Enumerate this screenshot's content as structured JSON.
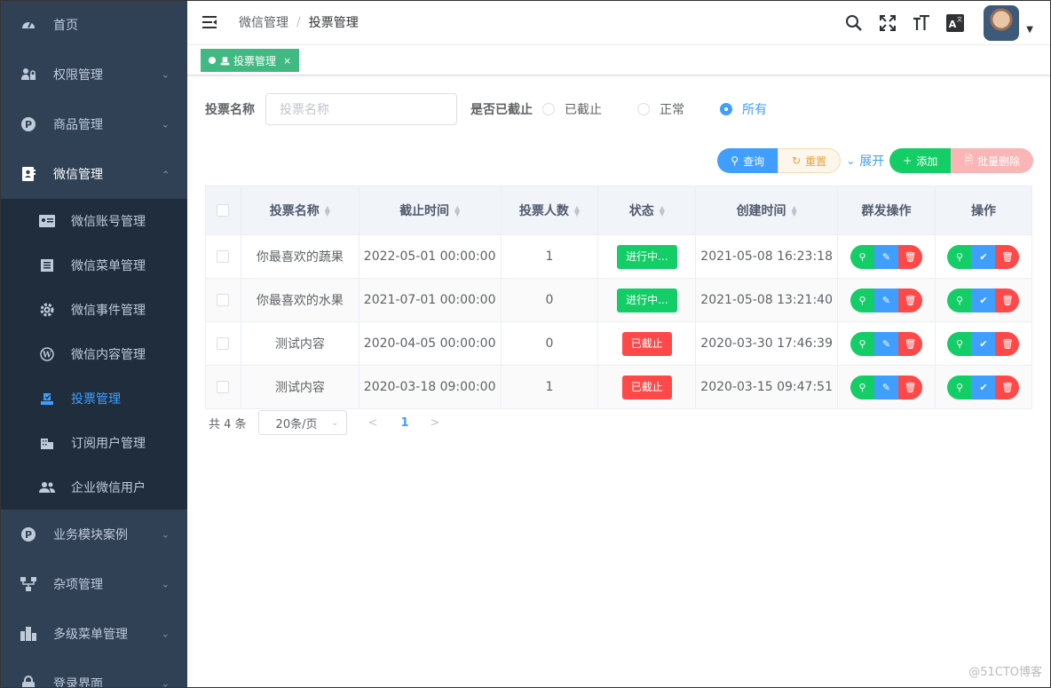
{
  "sidebar": {
    "home": "首页",
    "permission": "权限管理",
    "goods": "商品管理",
    "wechat": "微信管理",
    "wechat_sub": [
      {
        "label": "微信账号管理"
      },
      {
        "label": "微信菜单管理"
      },
      {
        "label": "微信事件管理"
      },
      {
        "label": "微信内容管理"
      },
      {
        "label": "投票管理"
      },
      {
        "label": "订阅用户管理"
      },
      {
        "label": "企业微信用户"
      }
    ],
    "business": "业务模块案例",
    "misc": "杂项管理",
    "multilevel": "多级菜单管理",
    "login": "登录界面"
  },
  "header": {
    "breadcrumb_parent": "微信管理",
    "breadcrumb_sep": "/",
    "breadcrumb_current": "投票管理"
  },
  "tags": {
    "active_label": "投票管理",
    "close": "×"
  },
  "search": {
    "name_label": "投票名称",
    "name_placeholder": "投票名称",
    "status_label": "是否已截止",
    "options": [
      "已截止",
      "正常",
      "所有"
    ],
    "selected": "所有"
  },
  "toolbar": {
    "query": "查询",
    "reset": "重置",
    "expand": "展开",
    "add": "添加",
    "batch_delete": "批量删除"
  },
  "table": {
    "headers": [
      "投票名称",
      "截止时间",
      "投票人数",
      "状态",
      "创建时间",
      "群发操作",
      "操作"
    ],
    "rows": [
      {
        "name": "你最喜欢的蔬果",
        "deadline": "2022-05-01 00:00:00",
        "count": "1",
        "status": "进行中...",
        "created": "2021-05-08 16:23:18"
      },
      {
        "name": "你最喜欢的水果",
        "deadline": "2021-07-01 00:00:00",
        "count": "0",
        "status": "进行中...",
        "created": "2021-05-08 13:21:40"
      },
      {
        "name": "测试内容",
        "deadline": "2020-04-05 00:00:00",
        "count": "0",
        "status": "已截止",
        "created": "2020-03-30 17:46:39"
      },
      {
        "name": "测试内容",
        "deadline": "2020-03-18 09:00:00",
        "count": "1",
        "status": "已截止",
        "created": "2020-03-15 09:47:51"
      }
    ]
  },
  "pagination": {
    "total": "共 4 条",
    "page_size": "20条/页",
    "current_page": "1"
  },
  "watermark": "@51CTO博客",
  "colors": {
    "sidebar_bg": "#304156",
    "accent": "#409eff",
    "success": "#13ce66",
    "danger": "#ff4949",
    "tag": "#42b983"
  }
}
